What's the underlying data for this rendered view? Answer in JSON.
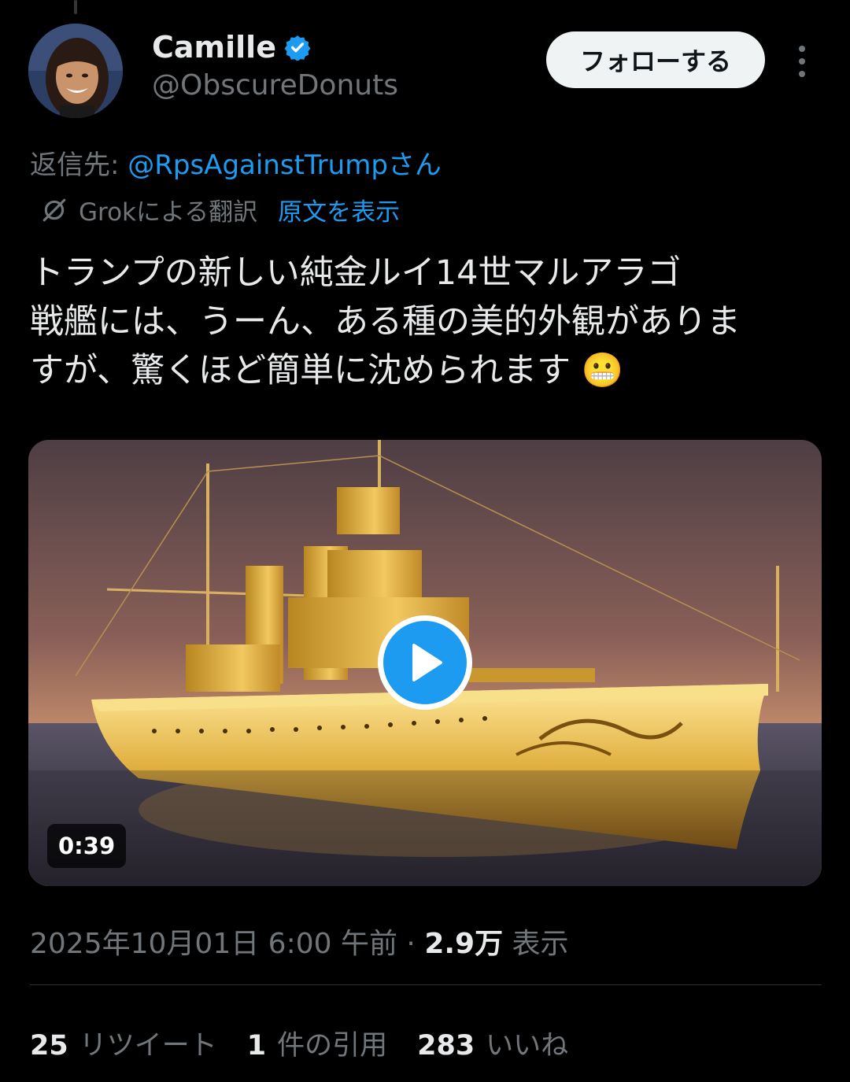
{
  "author": {
    "name": "Camille",
    "handle": "@ObscureDonuts",
    "verified": true
  },
  "follow_button": {
    "label": "フォローする"
  },
  "reply_to": {
    "prefix": "返信先: ",
    "mention": "@RpsAgainstTrumpさん"
  },
  "translation": {
    "label": "Grokによる翻訳",
    "show_original": "原文を表示"
  },
  "tweet": {
    "text": "トランプの新しい純金ルイ14世マルアラゴ\n戦艦には、うーん、ある種の美的外観がありま\nすが、驚くほど簡単に沈められます 😬"
  },
  "media": {
    "type": "video",
    "duration": "0:39"
  },
  "meta": {
    "timestamp": "2025年10月01日 6:00 午前",
    "separator": " · ",
    "views": "2.9万",
    "views_label": " 表示"
  },
  "stats": {
    "retweets_count": "25",
    "retweets_label": "リツイート",
    "quotes_count": "1",
    "quotes_label": "件の引用",
    "likes_count": "283",
    "likes_label": "いいね"
  },
  "colors": {
    "accent": "#1d9bf0",
    "background": "#000000",
    "secondary_text": "#71767b"
  }
}
